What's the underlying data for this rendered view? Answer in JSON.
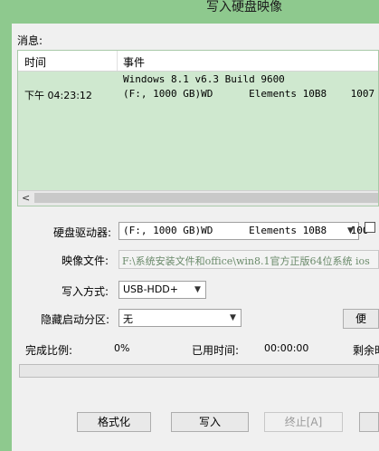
{
  "window": {
    "title": "写入硬盘映像"
  },
  "messages": {
    "label": "消息:",
    "columns": [
      "时间",
      "事件"
    ],
    "rows": [
      {
        "time": "",
        "event": "Windows 8.1 v6.3 Build 9600"
      },
      {
        "time": "下午 04:23:12",
        "event": "(F:, 1000 GB)WD      Elements 10B8    1007"
      }
    ]
  },
  "form": {
    "drive_label": "硬盘驱动器:",
    "drive_value": "(F:, 1000 GB)WD      Elements 10B8    100",
    "image_label": "映像文件:",
    "image_value": "F:\\系统安装文件和office\\win8.1官方正版64位系统 ios",
    "method_label": "写入方式:",
    "method_value": "USB-HDD+",
    "hidden_label": "隐藏启动分区:",
    "hidden_value": "无",
    "side_button": "便"
  },
  "status": {
    "progress_label": "完成比例:",
    "progress_value": "0%",
    "progress_fraction": 0,
    "elapsed_label": "已用时间:",
    "elapsed_value": "00:00:00",
    "remaining_label": "剩余时"
  },
  "buttons": {
    "format": "格式化",
    "write": "写入",
    "abort": "终止[A]"
  }
}
